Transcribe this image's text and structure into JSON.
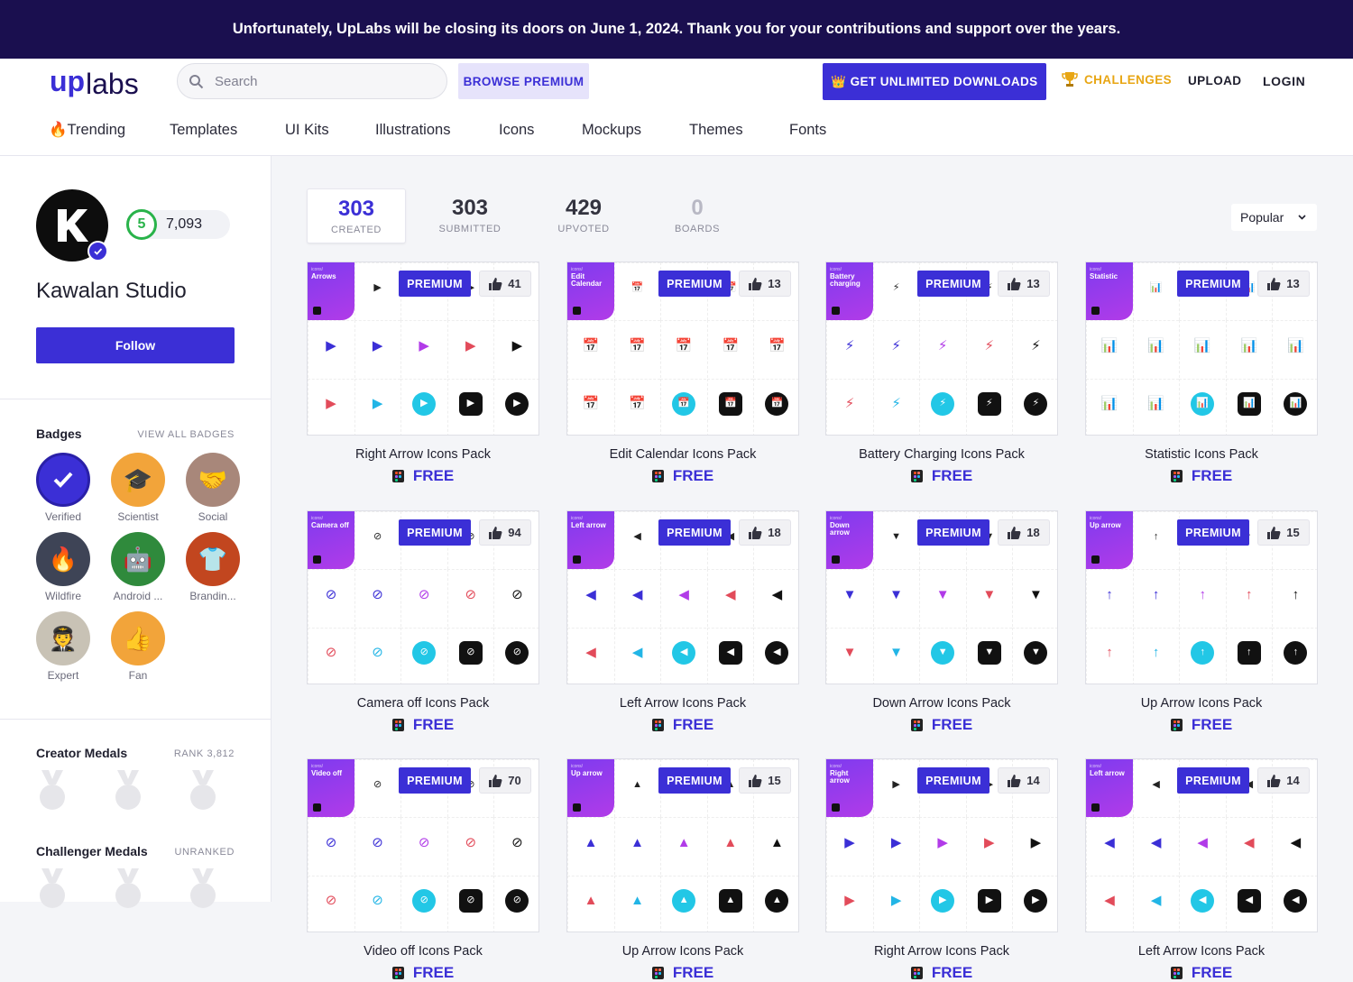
{
  "banner": {
    "text": "Unfortunately, UpLabs will be closing its doors on June 1, 2024. Thank you for your contributions and support over the years."
  },
  "header": {
    "logo_text": "uplabs",
    "search_placeholder": "Search",
    "browse_premium": "BROWSE PREMIUM",
    "unlimited": "GET UNLIMITED DOWNLOADS",
    "challenges": "CHALLENGES",
    "upload": "UPLOAD",
    "login": "LOGIN",
    "accent": "#3b2fd6"
  },
  "nav": {
    "items": [
      "🔥Trending",
      "Templates",
      "UI Kits",
      "Illustrations",
      "Icons",
      "Mockups",
      "Themes",
      "Fonts"
    ]
  },
  "profile": {
    "score_level": "5",
    "score": "7,093",
    "name": "Kawalan Studio",
    "follow": "Follow"
  },
  "badges": {
    "title": "Badges",
    "view_all": "VIEW ALL BADGES",
    "items": [
      {
        "label": "Verified",
        "icon": "check-icon"
      },
      {
        "label": "Scientist",
        "icon": "graduation-cap-icon"
      },
      {
        "label": "Social",
        "icon": "handshake-icon"
      },
      {
        "label": "Wildfire",
        "icon": "fire-icon"
      },
      {
        "label": "Android ...",
        "icon": "robot-icon"
      },
      {
        "label": "Brandin...",
        "icon": "shirt-icon"
      },
      {
        "label": "Expert",
        "icon": "expert-icon"
      },
      {
        "label": "Fan",
        "icon": "thumbs-up-icon"
      }
    ]
  },
  "creator_medals": {
    "title": "Creator Medals",
    "rank": "RANK 3,812"
  },
  "challenger_medals": {
    "title": "Challenger Medals",
    "rank": "UNRANKED"
  },
  "stats": [
    {
      "value": "303",
      "label": "CREATED"
    },
    {
      "value": "303",
      "label": "SUBMITTED"
    },
    {
      "value": "429",
      "label": "UPVOTED"
    },
    {
      "value": "0",
      "label": "BOARDS"
    }
  ],
  "sort": {
    "selected": "Popular"
  },
  "cards_premium_label": "PREMIUM",
  "cards_price_label": "FREE",
  "cards": [
    {
      "title": "Right Arrow Icons Pack",
      "likes": "41",
      "tab": "Arrows",
      "glyph": "▶"
    },
    {
      "title": "Edit Calendar Icons Pack",
      "likes": "13",
      "tab": "Edit Calendar",
      "glyph": "📅"
    },
    {
      "title": "Battery Charging Icons Pack",
      "likes": "13",
      "tab": "Battery charging",
      "glyph": "⚡"
    },
    {
      "title": "Statistic Icons Pack",
      "likes": "13",
      "tab": "Statistic",
      "glyph": "📊"
    },
    {
      "title": "Camera off Icons Pack",
      "likes": "94",
      "tab": "Camera off",
      "glyph": "⊘"
    },
    {
      "title": "Left Arrow Icons Pack",
      "likes": "18",
      "tab": "Left arrow",
      "glyph": "◀"
    },
    {
      "title": "Down Arrow Icons Pack",
      "likes": "18",
      "tab": "Down arrow",
      "glyph": "▼"
    },
    {
      "title": "Up Arrow Icons Pack",
      "likes": "15",
      "tab": "Up arrow",
      "glyph": "↑"
    },
    {
      "title": "Video off Icons Pack",
      "likes": "70",
      "tab": "Video off",
      "glyph": "⊘"
    },
    {
      "title": "Up Arrow Icons Pack",
      "likes": "15",
      "tab": "Up arrow",
      "glyph": "▲"
    },
    {
      "title": "Right Arrow Icons Pack",
      "likes": "14",
      "tab": "Right arrow",
      "glyph": "▶"
    },
    {
      "title": "Left Arrow Icons Pack",
      "likes": "14",
      "tab": "Left arrow",
      "glyph": "◀"
    }
  ]
}
